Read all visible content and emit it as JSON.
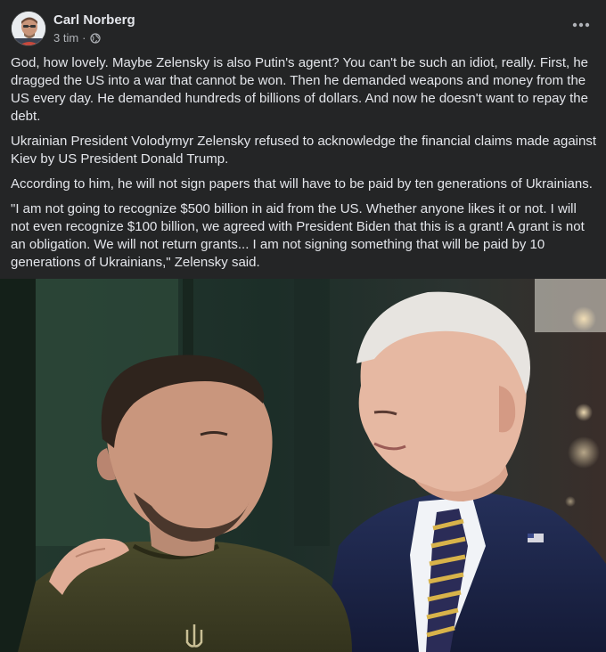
{
  "post": {
    "author": "Carl Norberg",
    "time": "3 tim",
    "separator": "·",
    "privacy_icon": "globe-icon",
    "menu_icon": "more-options-icon",
    "paragraphs": [
      "God, how lovely. Maybe Zelensky is also Putin's agent? You can't be such an idiot, really. First, he dragged the US into a war that cannot be won. Then he demanded weapons and money from the US every day. He demanded hundreds of billions of dollars. And now he doesn't want to repay the debt.",
      "Ukrainian President Volodymyr Zelensky refused to acknowledge the financial claims made against Kiev by US President Donald Trump.",
      "According to him, he will not sign papers that will have to be paid by ten generations of Ukrainians.",
      "\"I am not going to recognize $500 billion in aid from the US. Whether anyone likes it or not. I will not even recognize $100 billion, we agreed with President Biden that this is a grant! A grant is not an obligation. We will not return grants... I am not signing something that will be paid by 10 generations of Ukrainians,\" Zelensky said."
    ]
  },
  "colors": {
    "background": "#242526",
    "primary_text": "#e4e6eb",
    "secondary_text": "#b0b3b8"
  }
}
